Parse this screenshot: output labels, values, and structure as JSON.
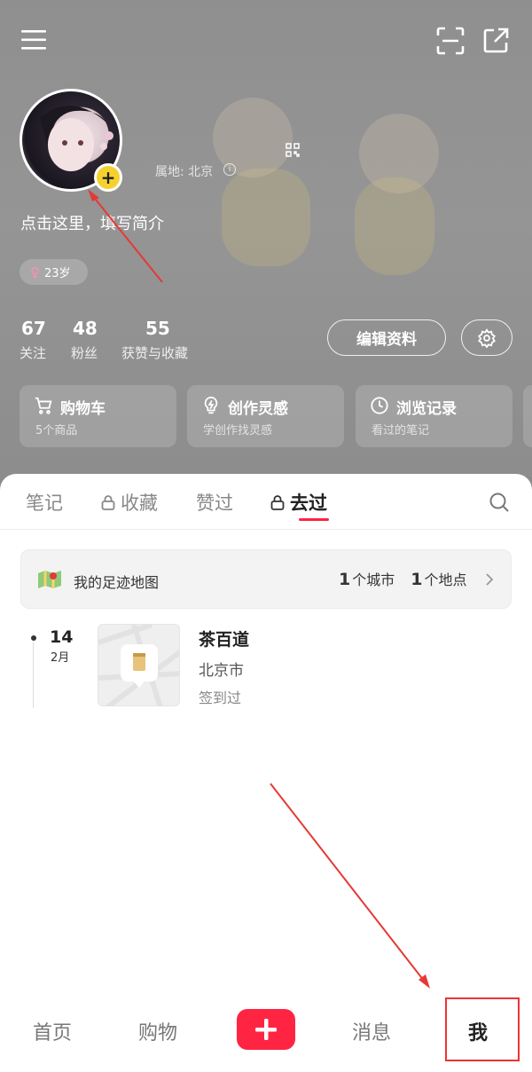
{
  "profile": {
    "location_label": "属地: 北京",
    "bio_placeholder": "点击这里，填写简介",
    "age_tag": "23岁",
    "stats": [
      {
        "value": "67",
        "label": "关注"
      },
      {
        "value": "48",
        "label": "粉丝"
      },
      {
        "value": "55",
        "label": "获赞与收藏"
      }
    ],
    "edit_button": "编辑资料"
  },
  "quick_cards": [
    {
      "title": "购物车",
      "subtitle": "5个商品",
      "icon": "cart-icon"
    },
    {
      "title": "创作灵感",
      "subtitle": "学创作找灵感",
      "icon": "lightbulb-icon"
    },
    {
      "title": "浏览记录",
      "subtitle": "看过的笔记",
      "icon": "clock-icon"
    }
  ],
  "tabs": [
    {
      "label": "笔记",
      "locked": false,
      "active": false
    },
    {
      "label": "收藏",
      "locked": true,
      "active": false
    },
    {
      "label": "赞过",
      "locked": false,
      "active": false
    },
    {
      "label": "去过",
      "locked": true,
      "active": true
    }
  ],
  "footprint": {
    "title": "我的足迹地图",
    "cities_num": "1",
    "cities_label": "个城市",
    "places_num": "1",
    "places_label": "个地点"
  },
  "visit": {
    "day": "14",
    "month": "2月",
    "name": "茶百道",
    "city": "北京市",
    "status": "签到过"
  },
  "bottom_nav": [
    "首页",
    "购物",
    "消息",
    "我"
  ],
  "colors": {
    "accent": "#ff2442",
    "annotation": "#e53935",
    "avatar_badge": "#f5d130"
  }
}
